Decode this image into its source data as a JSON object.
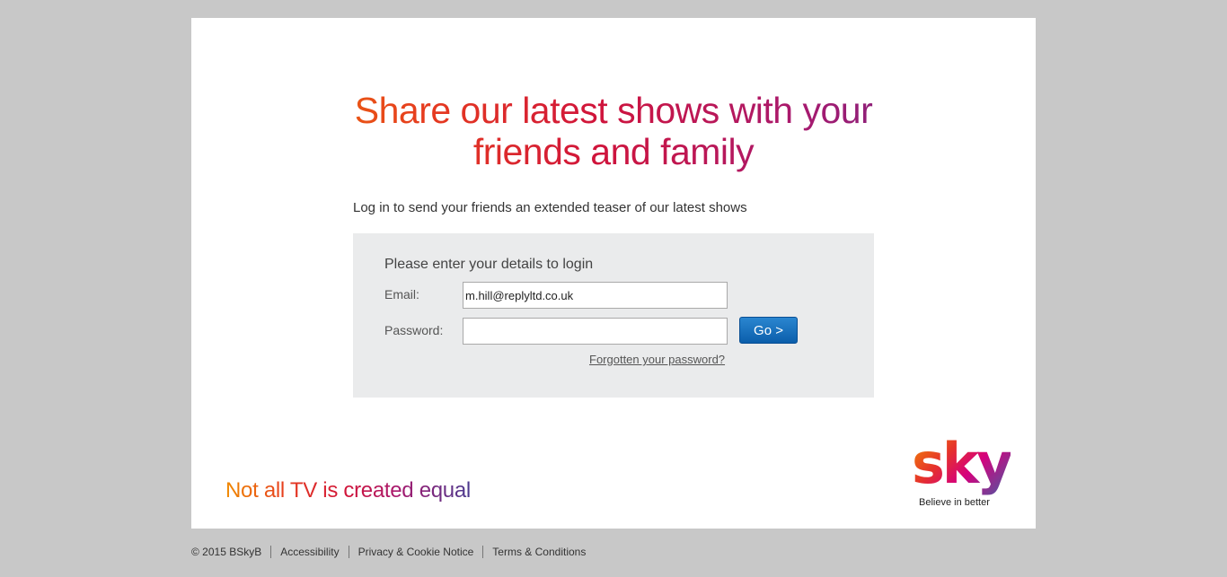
{
  "headline": {
    "line1": "Share our latest shows with your",
    "line2": "friends and family"
  },
  "intro_text": "Log in to send your friends an extended teaser of our latest shows",
  "login": {
    "heading": "Please enter your details to login",
    "email_label": "Email:",
    "email_value": "m.hill@replyltd.co.uk",
    "password_label": "Password:",
    "password_value": "",
    "go_label": "Go >",
    "forgot_label": "Forgotten your password?"
  },
  "tagline": "Not all TV is created equal",
  "logo": {
    "word": "sky",
    "caption": "Believe in better"
  },
  "footer": {
    "copyright": "© 2015 BSkyB",
    "links": [
      "Accessibility",
      "Privacy & Cookie Notice",
      "Terms & Conditions"
    ]
  },
  "colors": {
    "page_background": "#c8c8c8",
    "panel_background": "#ffffff",
    "login_box_background": "#eaebec",
    "button_blue": "#1a73c2",
    "gradient_orange": "#f08a00",
    "gradient_red": "#d0143b",
    "gradient_purple": "#5a2e8f"
  }
}
